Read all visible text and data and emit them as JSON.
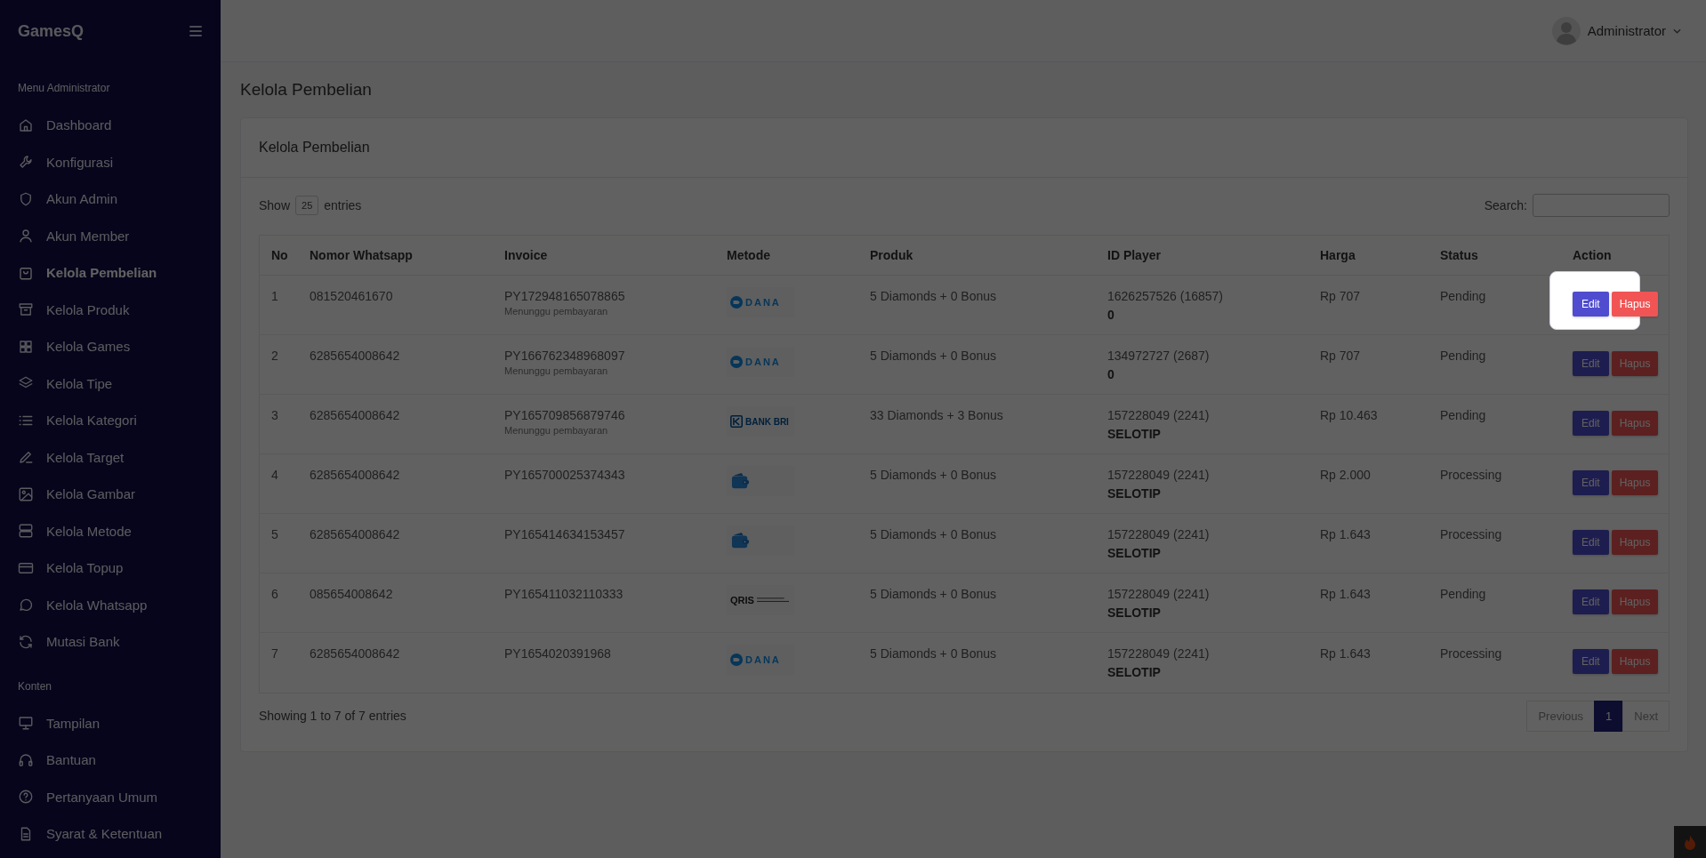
{
  "brand": "GamesQ",
  "user": {
    "name": "Administrator"
  },
  "sidebar": {
    "sections": [
      {
        "title": "Menu Administrator",
        "items": [
          {
            "label": "Dashboard",
            "selected": false
          },
          {
            "label": "Konfigurasi",
            "selected": false
          },
          {
            "label": "Akun Admin",
            "selected": false
          },
          {
            "label": "Akun Member",
            "selected": false
          },
          {
            "label": "Kelola Pembelian",
            "selected": true
          },
          {
            "label": "Kelola Produk",
            "selected": false
          },
          {
            "label": "Kelola Games",
            "selected": false
          },
          {
            "label": "Kelola Tipe",
            "selected": false
          },
          {
            "label": "Kelola Kategori",
            "selected": false
          },
          {
            "label": "Kelola Target",
            "selected": false
          },
          {
            "label": "Kelola Gambar",
            "selected": false
          },
          {
            "label": "Kelola Metode",
            "selected": false
          },
          {
            "label": "Kelola Topup",
            "selected": false
          },
          {
            "label": "Kelola Whatsapp",
            "selected": false
          },
          {
            "label": "Mutasi Bank",
            "selected": false
          }
        ]
      },
      {
        "title": "Konten",
        "items": [
          {
            "label": "Tampilan",
            "selected": false
          },
          {
            "label": "Bantuan",
            "selected": false
          },
          {
            "label": "Pertanyaan Umum",
            "selected": false
          },
          {
            "label": "Syarat & Ketentuan",
            "selected": false
          }
        ]
      }
    ]
  },
  "page_title": "Kelola Pembelian",
  "card": {
    "title": "Kelola Pembelian",
    "length": {
      "before": "Show",
      "value": "25",
      "after": "entries"
    },
    "search": {
      "label": "Search:"
    },
    "table": {
      "columns": [
        "No",
        "Nomor Whatsapp",
        "Invoice",
        "Metode",
        "Produk",
        "ID Player",
        "Harga",
        "Status",
        "Action"
      ],
      "rows": [
        {
          "no": "1",
          "whatsapp": "081520461670",
          "invoice": "PY172948165078865",
          "note": "Menunggu pembayaran",
          "method": {
            "kind": "dana",
            "label": "DANA"
          },
          "product": "5 Diamonds + 0 Bonus",
          "player_id": "1626257526 (16857)",
          "player_name": "0",
          "price": "Rp 707",
          "status": "Pending",
          "edit": "Edit",
          "delete": "Hapus",
          "highlighted": true
        },
        {
          "no": "2",
          "whatsapp": "6285654008642",
          "invoice": "PY166762348968097",
          "note": "Menunggu pembayaran",
          "method": {
            "kind": "dana",
            "label": "DANA"
          },
          "product": "5 Diamonds + 0 Bonus",
          "player_id": "134972727 (2687)",
          "player_name": "0",
          "price": "Rp 707",
          "status": "Pending",
          "edit": "Edit",
          "delete": "Hapus",
          "highlighted": false
        },
        {
          "no": "3",
          "whatsapp": "6285654008642",
          "invoice": "PY165709856879746",
          "note": "Menunggu pembayaran",
          "method": {
            "kind": "bri",
            "label": "BANK BRI"
          },
          "product": "33 Diamonds + 3 Bonus",
          "player_id": "157228049 (2241)",
          "player_name": "SELOTIP",
          "price": "Rp 10.463",
          "status": "Pending",
          "edit": "Edit",
          "delete": "Hapus",
          "highlighted": false
        },
        {
          "no": "4",
          "whatsapp": "6285654008642",
          "invoice": "PY165700025374343",
          "method": {
            "kind": "wallet"
          },
          "product": "5 Diamonds + 0 Bonus",
          "player_id": "157228049 (2241)",
          "player_name": "SELOTIP",
          "price": "Rp 2.000",
          "status": "Processing",
          "edit": "Edit",
          "delete": "Hapus",
          "highlighted": false
        },
        {
          "no": "5",
          "whatsapp": "6285654008642",
          "invoice": "PY165414634153457",
          "method": {
            "kind": "wallet"
          },
          "product": "5 Diamonds + 0 Bonus",
          "player_id": "157228049 (2241)",
          "player_name": "SELOTIP",
          "price": "Rp 1.643",
          "status": "Processing",
          "edit": "Edit",
          "delete": "Hapus",
          "highlighted": false
        },
        {
          "no": "6",
          "whatsapp": "085654008642",
          "invoice": "PY165411032110333",
          "method": {
            "kind": "qris",
            "label": "QRIS"
          },
          "product": "5 Diamonds + 0 Bonus",
          "player_id": "157228049 (2241)",
          "player_name": "SELOTIP",
          "price": "Rp 1.643",
          "status": "Pending",
          "edit": "Edit",
          "delete": "Hapus",
          "highlighted": false
        },
        {
          "no": "7",
          "whatsapp": "6285654008642",
          "invoice": "PY1654020391968",
          "method": {
            "kind": "dana",
            "label": "DANA"
          },
          "product": "5 Diamonds + 0 Bonus",
          "player_id": "157228049 (2241)",
          "player_name": "SELOTIP",
          "price": "Rp 1.643",
          "status": "Processing",
          "edit": "Edit",
          "delete": "Hapus",
          "highlighted": false
        }
      ]
    },
    "info": "Showing 1 to 7 of 7 entries",
    "pagination": {
      "previous": {
        "label": "Previous",
        "disabled": true
      },
      "pages": [
        {
          "label": "1",
          "selected": true
        }
      ],
      "next": {
        "label": "Next",
        "disabled": true
      }
    }
  }
}
